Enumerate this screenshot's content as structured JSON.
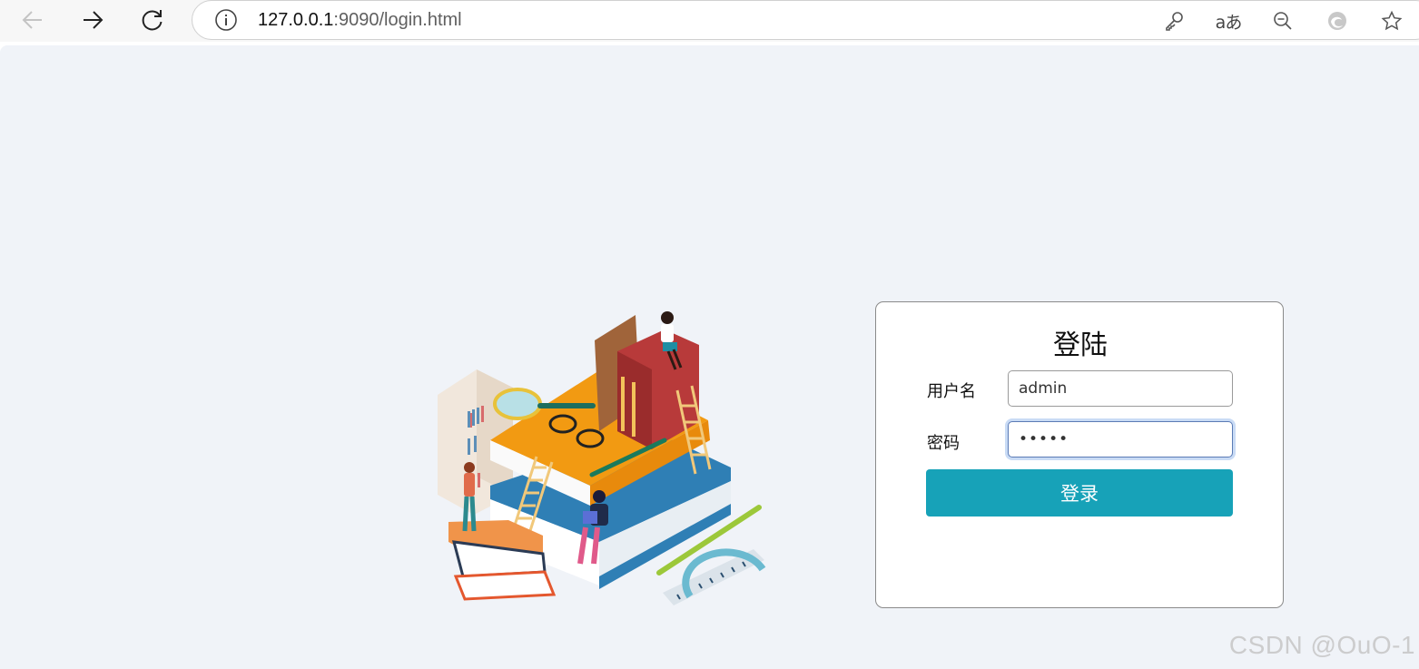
{
  "browser": {
    "url_host": "127.0.0.1",
    "url_rest": ":9090/login.html",
    "icons": [
      "back-icon",
      "forward-icon",
      "refresh-icon",
      "info-icon",
      "key-icon",
      "read-aloud-icon",
      "zoom-out-icon",
      "edge-icon",
      "favorite-star-icon"
    ],
    "translate_label": "aあ"
  },
  "login": {
    "title": "登陆",
    "username_label": "用户名",
    "username_value": "admin",
    "password_label": "密码",
    "password_value": "•••••",
    "submit_label": "登录"
  },
  "watermark": "CSDN @OuO-1",
  "colors": {
    "page_bg": "#f0f3f8",
    "button": "#17a2b8",
    "card_border": "#8a8a8a"
  }
}
